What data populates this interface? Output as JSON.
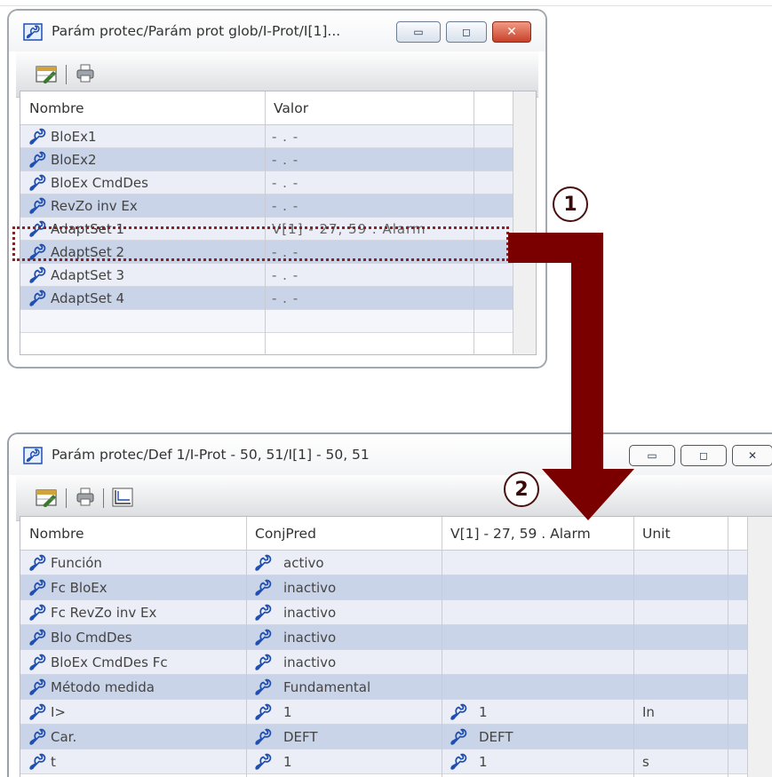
{
  "colors": {
    "arrow": "#7a0000",
    "highlight": "#9e1b1b",
    "row": "#ebeef6",
    "row_alt": "#c9d4e8"
  },
  "window1": {
    "title": "Parám protec/Parám prot glob/I-Prot/I[1]...",
    "toolbar": [
      "table-edit-icon",
      "printer-icon"
    ],
    "headers": {
      "name": "Nombre",
      "value": "Valor"
    },
    "rows": [
      {
        "name": "BloEx1",
        "value": "- . -"
      },
      {
        "name": "BloEx2",
        "value": "- . -"
      },
      {
        "name": "BloEx CmdDes",
        "value": "- . -"
      },
      {
        "name": "RevZo inv Ex",
        "value": "- . -"
      },
      {
        "name": "AdaptSet 1",
        "value": "V[1] - 27, 59 . Alarm"
      },
      {
        "name": "AdaptSet 2",
        "value": "- . -"
      },
      {
        "name": "AdaptSet 3",
        "value": "- . -"
      },
      {
        "name": "AdaptSet 4",
        "value": "- . -"
      }
    ]
  },
  "window2": {
    "title": "Parám protec/Def 1/I-Prot - 50, 51/I[1] - 50, 51",
    "toolbar": [
      "table-edit-icon",
      "printer-icon",
      "chart-icon"
    ],
    "headers": {
      "name": "Nombre",
      "default": "ConjPred",
      "adapt": "V[1] - 27, 59 . Alarm",
      "unit": "Unit"
    },
    "rows": [
      {
        "name": "Función",
        "default": "activo",
        "adapt": "",
        "unit": ""
      },
      {
        "name": "Fc BloEx",
        "default": "inactivo",
        "adapt": "",
        "unit": ""
      },
      {
        "name": "Fc RevZo inv Ex",
        "default": "inactivo",
        "adapt": "",
        "unit": ""
      },
      {
        "name": "Blo CmdDes",
        "default": "inactivo",
        "adapt": "",
        "unit": ""
      },
      {
        "name": "BloEx CmdDes Fc",
        "default": "inactivo",
        "adapt": "",
        "unit": ""
      },
      {
        "name": "Método medida",
        "default": "Fundamental",
        "adapt": "",
        "unit": ""
      },
      {
        "name": "I>",
        "default": "1",
        "adapt": "1",
        "unit": "In"
      },
      {
        "name": "Car.",
        "default": "DEFT",
        "adapt": "DEFT",
        "unit": ""
      },
      {
        "name": "t",
        "default": "1",
        "adapt": "1",
        "unit": "s"
      }
    ]
  },
  "annotations": {
    "step1": "1",
    "step2": "2"
  }
}
